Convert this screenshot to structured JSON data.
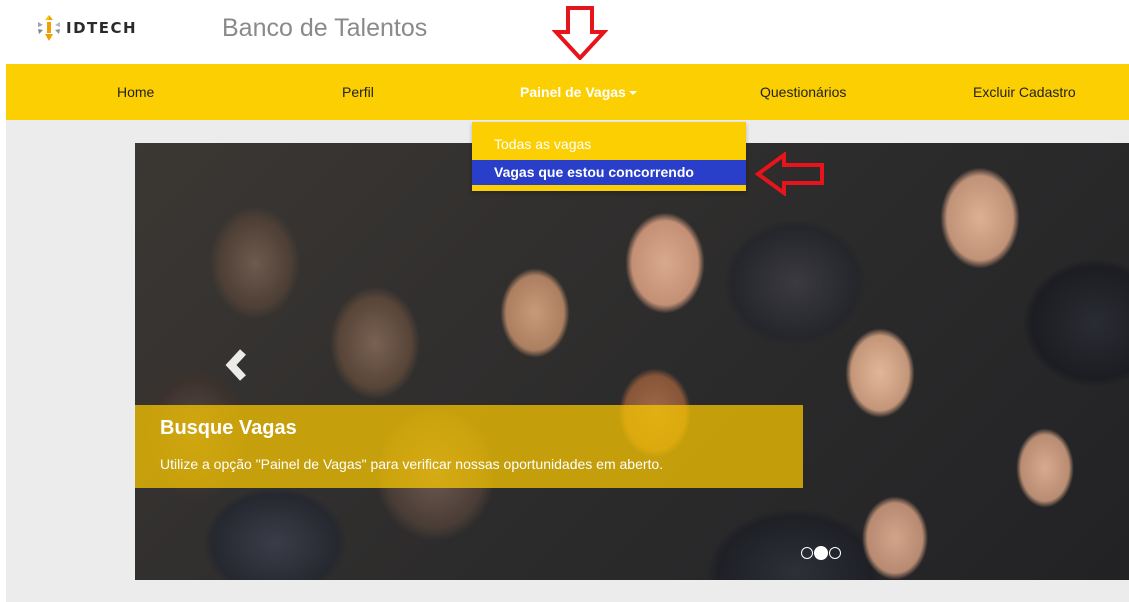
{
  "header": {
    "logo_text": "IDTECH",
    "app_title": "Banco de Talentos"
  },
  "nav": {
    "items": [
      {
        "label": "Home"
      },
      {
        "label": "Perfil"
      },
      {
        "label": "Painel de Vagas",
        "active": true
      },
      {
        "label": "Questionários"
      },
      {
        "label": "Excluir Cadastro"
      }
    ]
  },
  "dropdown": {
    "items": [
      {
        "label": "Todas as vagas"
      },
      {
        "label": "Vagas que estou concorrendo",
        "highlighted": true
      }
    ]
  },
  "carousel": {
    "caption_title": "Busque Vagas",
    "caption_text": "Utilize a opção \"Painel de Vagas\" para verificar nossas oportunidades em aberto.",
    "indicator_count": 3,
    "active_indicator": 2
  },
  "colors": {
    "navbar": "#fccf03",
    "dropdown_highlight": "#2a3fc9",
    "annotation_arrow": "#e8141b"
  },
  "icons": [
    "idtech-logo-icon",
    "chevron-left-icon",
    "arrow-down-icon",
    "arrow-left-icon"
  ]
}
